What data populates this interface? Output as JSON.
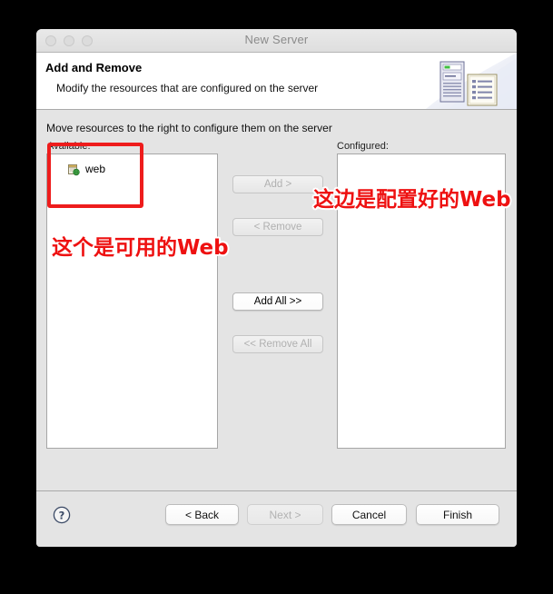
{
  "window": {
    "title": "New Server",
    "traffic_lights": [
      "close",
      "minimize",
      "zoom"
    ]
  },
  "header": {
    "title": "Add and Remove",
    "subtitle": "Modify the resources that are configured on the server",
    "banner_icon": "server-document-icon"
  },
  "main": {
    "instruction": "Move resources to the right to configure them on the server",
    "available": {
      "label": "Available:",
      "items": [
        {
          "icon": "web-module-icon",
          "label": "web"
        }
      ]
    },
    "configured": {
      "label": "Configured:",
      "items": []
    },
    "transfer_buttons": [
      {
        "label": "Add >",
        "enabled": false
      },
      {
        "label": "< Remove",
        "enabled": false
      },
      {
        "label": "Add All >>",
        "enabled": true
      },
      {
        "label": "<< Remove All",
        "enabled": false
      }
    ]
  },
  "footer": {
    "help_icon": "help-question-icon",
    "buttons": [
      {
        "label": "< Back",
        "enabled": true
      },
      {
        "label": "Next >",
        "enabled": false
      },
      {
        "label": "Cancel",
        "enabled": true
      },
      {
        "label": "Finish",
        "enabled": true
      }
    ]
  },
  "annotations": {
    "highlight_box": "available-list-highlight",
    "text_left": "这个是可用的Web",
    "text_right": "这边是配置好的Web",
    "color": "#ee1111"
  }
}
